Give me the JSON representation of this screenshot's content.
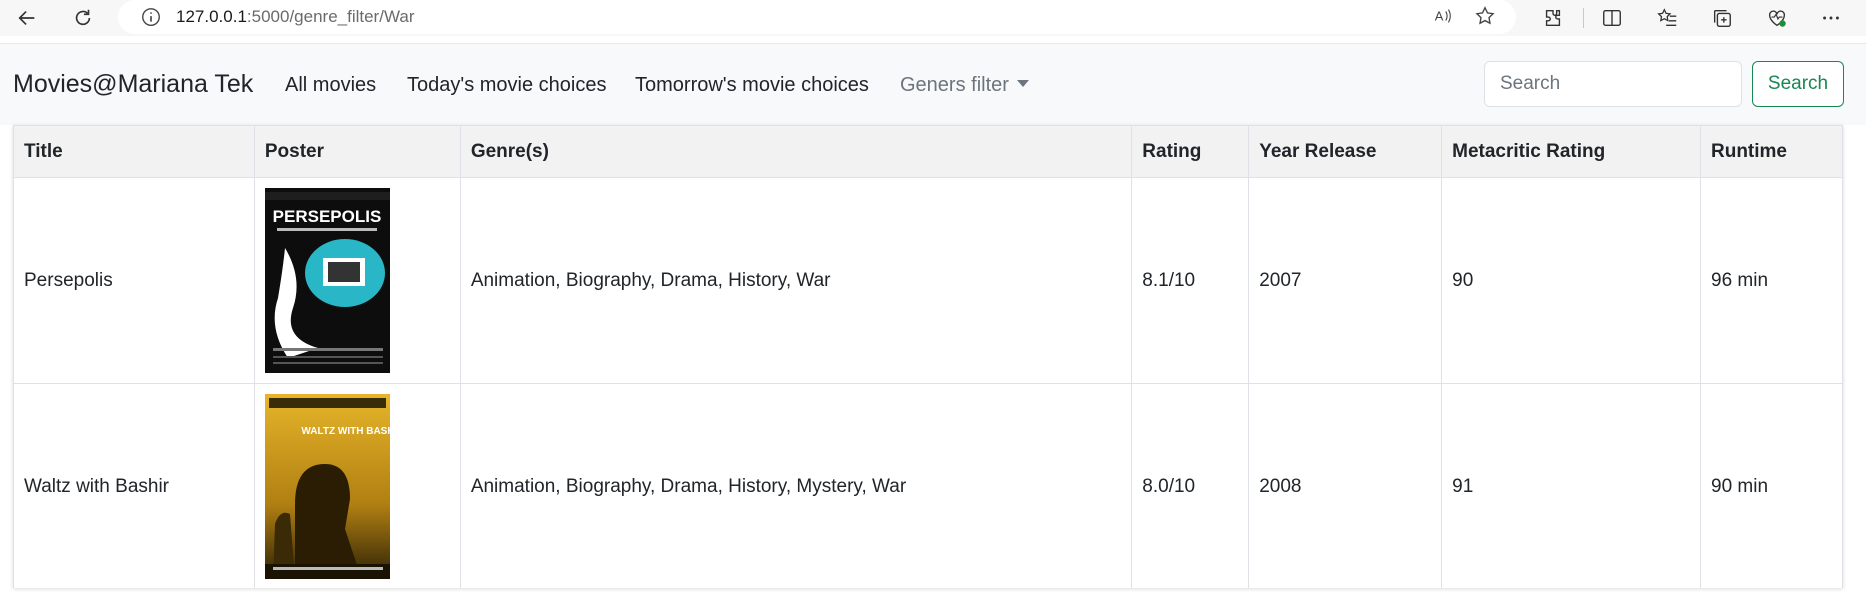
{
  "browser": {
    "url_host": "127.0.0.1",
    "url_rest": ":5000/genre_filter/War"
  },
  "navbar": {
    "brand": "Movies@Mariana Tek",
    "links": [
      "All movies",
      "Today's movie choices",
      "Tomorrow's movie choices"
    ],
    "dropdown_label": "Geners filter",
    "search_placeholder": "Search",
    "search_button": "Search"
  },
  "table": {
    "headers": [
      "Title",
      "Poster",
      "Genre(s)",
      "Rating",
      "Year Release",
      "Metacritic Rating",
      "Runtime"
    ],
    "rows": [
      {
        "title": "Persepolis",
        "poster": "PERSEPOLIS",
        "genres": "Animation, Biography, Drama, History, War",
        "rating": "8.1/10",
        "year": "2007",
        "metacritic": "90",
        "runtime": "96 min"
      },
      {
        "title": "Waltz with Bashir",
        "poster": "WALTZ WITH BASHIR",
        "genres": "Animation, Biography, Drama, History, Mystery, War",
        "rating": "8.0/10",
        "year": "2008",
        "metacritic": "91",
        "runtime": "90 min"
      }
    ]
  },
  "colors": {
    "accent_green": "#198754",
    "navbar_bg": "#f8f9fa",
    "persepolis_teal": "#29b6c6",
    "bashir_yellow": "#d8a51a"
  }
}
